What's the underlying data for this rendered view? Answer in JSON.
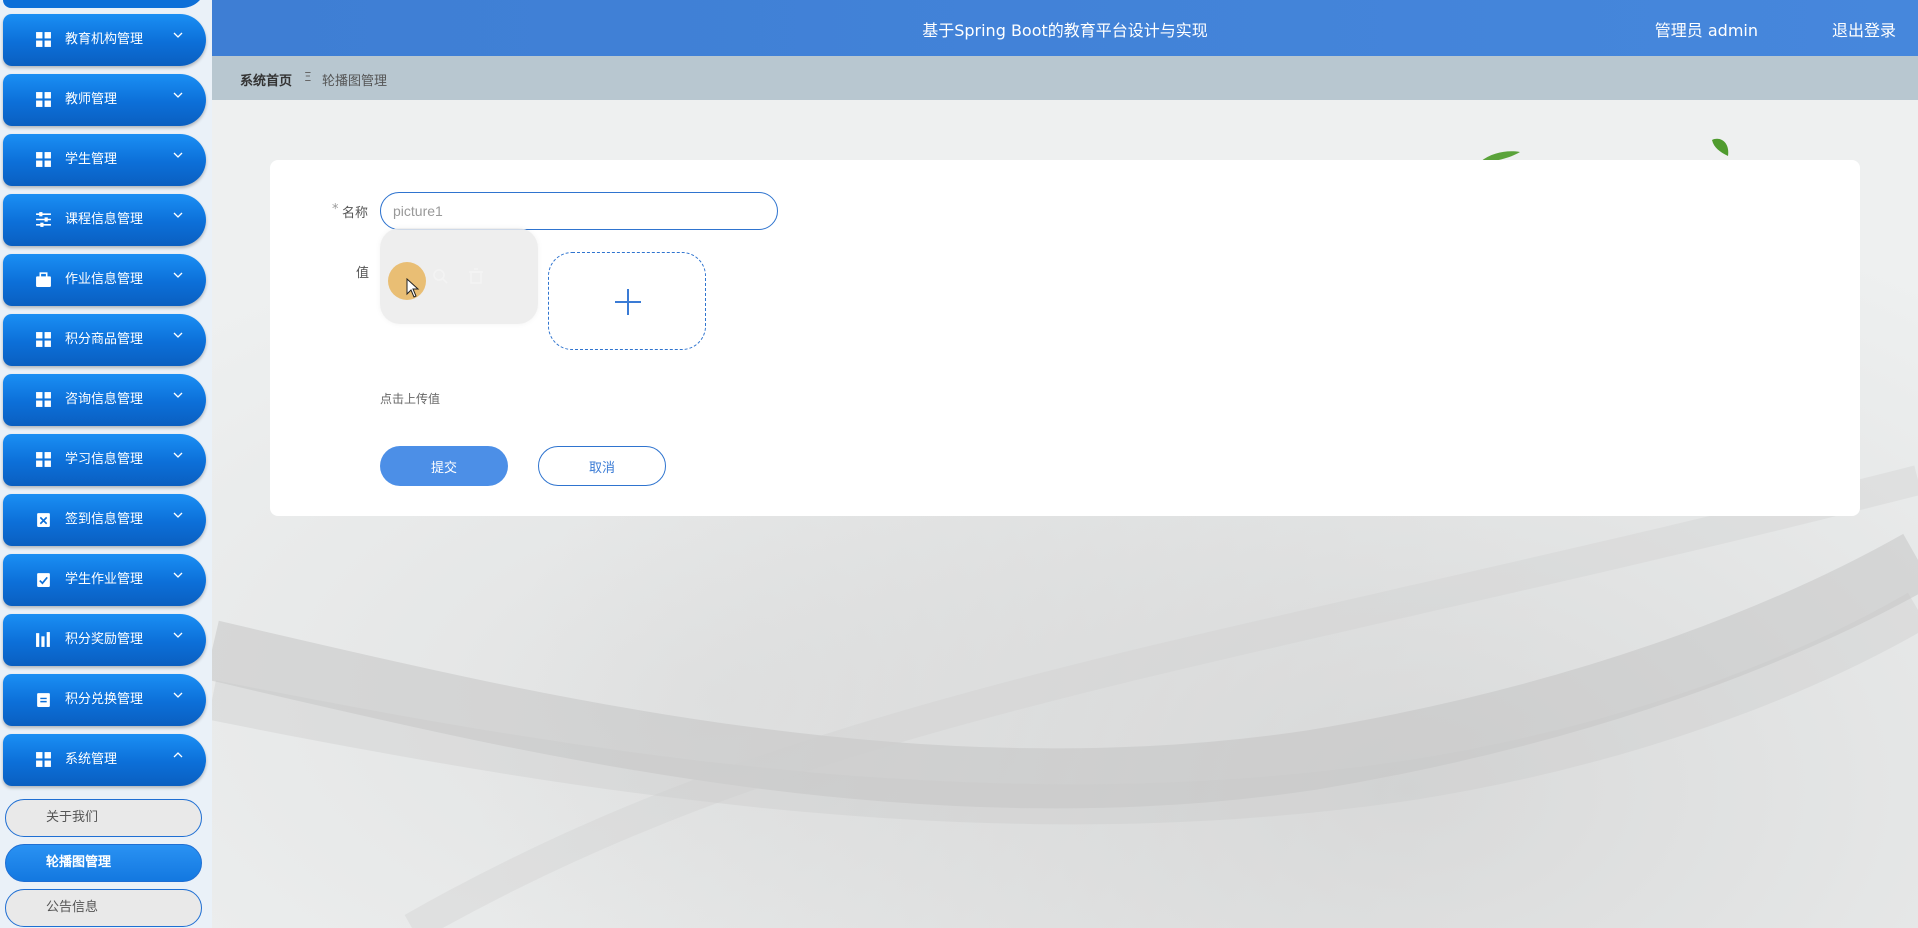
{
  "header": {
    "title": "基于Spring Boot的教育平台设计与实现",
    "user": "管理员 admin",
    "logout": "退出登录"
  },
  "breadcrumb": {
    "home": "系统首页",
    "separator": "Ξ",
    "current": "轮播图管理"
  },
  "sidebar": {
    "items": [
      {
        "label": "教育机构管理",
        "icon": "grid-icon"
      },
      {
        "label": "教师管理",
        "icon": "grid-icon"
      },
      {
        "label": "学生管理",
        "icon": "grid-icon"
      },
      {
        "label": "课程信息管理",
        "icon": "sliders-icon"
      },
      {
        "label": "作业信息管理",
        "icon": "briefcase-icon"
      },
      {
        "label": "积分商品管理",
        "icon": "grid-icon"
      },
      {
        "label": "咨询信息管理",
        "icon": "grid-icon"
      },
      {
        "label": "学习信息管理",
        "icon": "grid-icon"
      },
      {
        "label": "签到信息管理",
        "icon": "clipboard-x-icon"
      },
      {
        "label": "学生作业管理",
        "icon": "clipboard-check-icon"
      },
      {
        "label": "积分奖励管理",
        "icon": "bars-icon"
      },
      {
        "label": "积分兑换管理",
        "icon": "clipboard-icon"
      },
      {
        "label": "系统管理",
        "icon": "grid-icon"
      }
    ],
    "sub_items": [
      {
        "label": "关于我们"
      },
      {
        "label": "轮播图管理"
      },
      {
        "label": "公告信息"
      }
    ]
  },
  "form": {
    "name_label": "名称",
    "required_mark": "*",
    "name_value": "picture1",
    "value_label": "值",
    "upload_hint": "点击上传值",
    "submit_label": "提交",
    "cancel_label": "取消"
  },
  "colors": {
    "header": "#3e7ed4",
    "menu": "#0c6fd8",
    "primary_button": "#4c8fe7",
    "breadcrumb_bg": "#b8c7d0"
  }
}
